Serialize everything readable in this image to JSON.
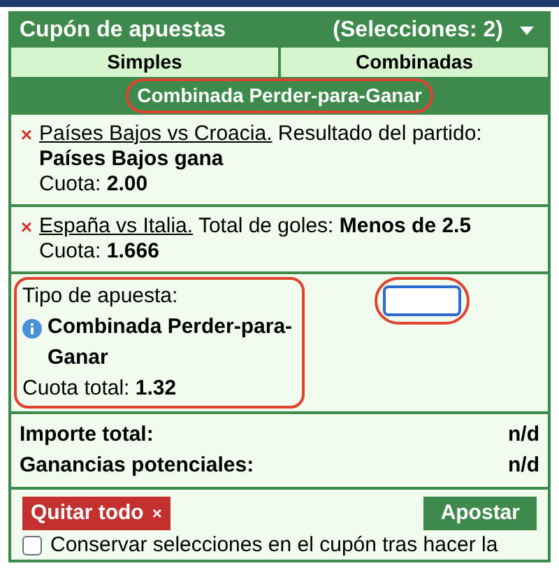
{
  "header": {
    "title": "Cupón de apuestas",
    "count": "(Selecciones: 2)",
    "expanded": true
  },
  "tabs": [
    {
      "label": "Simples",
      "selected": false
    },
    {
      "label": "Combinadas",
      "selected": false
    }
  ],
  "subtitle": {
    "text": "Combinada Perder-para-Ganar",
    "highlighted": true
  },
  "selections": [
    {
      "remove": "×",
      "event": "Países Bajos vs Croacia.",
      "market": "Resultado del partido:",
      "pick": "Países Bajos gana",
      "odds_label": "Cuota:",
      "odds": "2.00"
    },
    {
      "remove": "×",
      "event": "España vs Italia.",
      "market": "Total de goles:",
      "pick": "Menos de 2.5",
      "odds_label": "Cuota:",
      "odds": "1.666"
    }
  ],
  "bet_type": {
    "label": "Tipo de apuesta:",
    "name": "Combinada Perder-para-Ganar",
    "total_label": "Cuota total:",
    "total": "1.32",
    "highlighted": true
  },
  "stake_field": {
    "focused": true,
    "highlighted": true
  },
  "totals": [
    {
      "label": "Importe total:",
      "value": "n/d"
    },
    {
      "label": "Ganancias potenciales:",
      "value": "n/d"
    }
  ],
  "remove_all": {
    "label": "Quitar todo",
    "icon": "×"
  },
  "place_bet": {
    "label": "Apostar"
  },
  "keep_selections": {
    "label": "Conservar selecciones en el cupón tras hacer la",
    "checked": false
  }
}
